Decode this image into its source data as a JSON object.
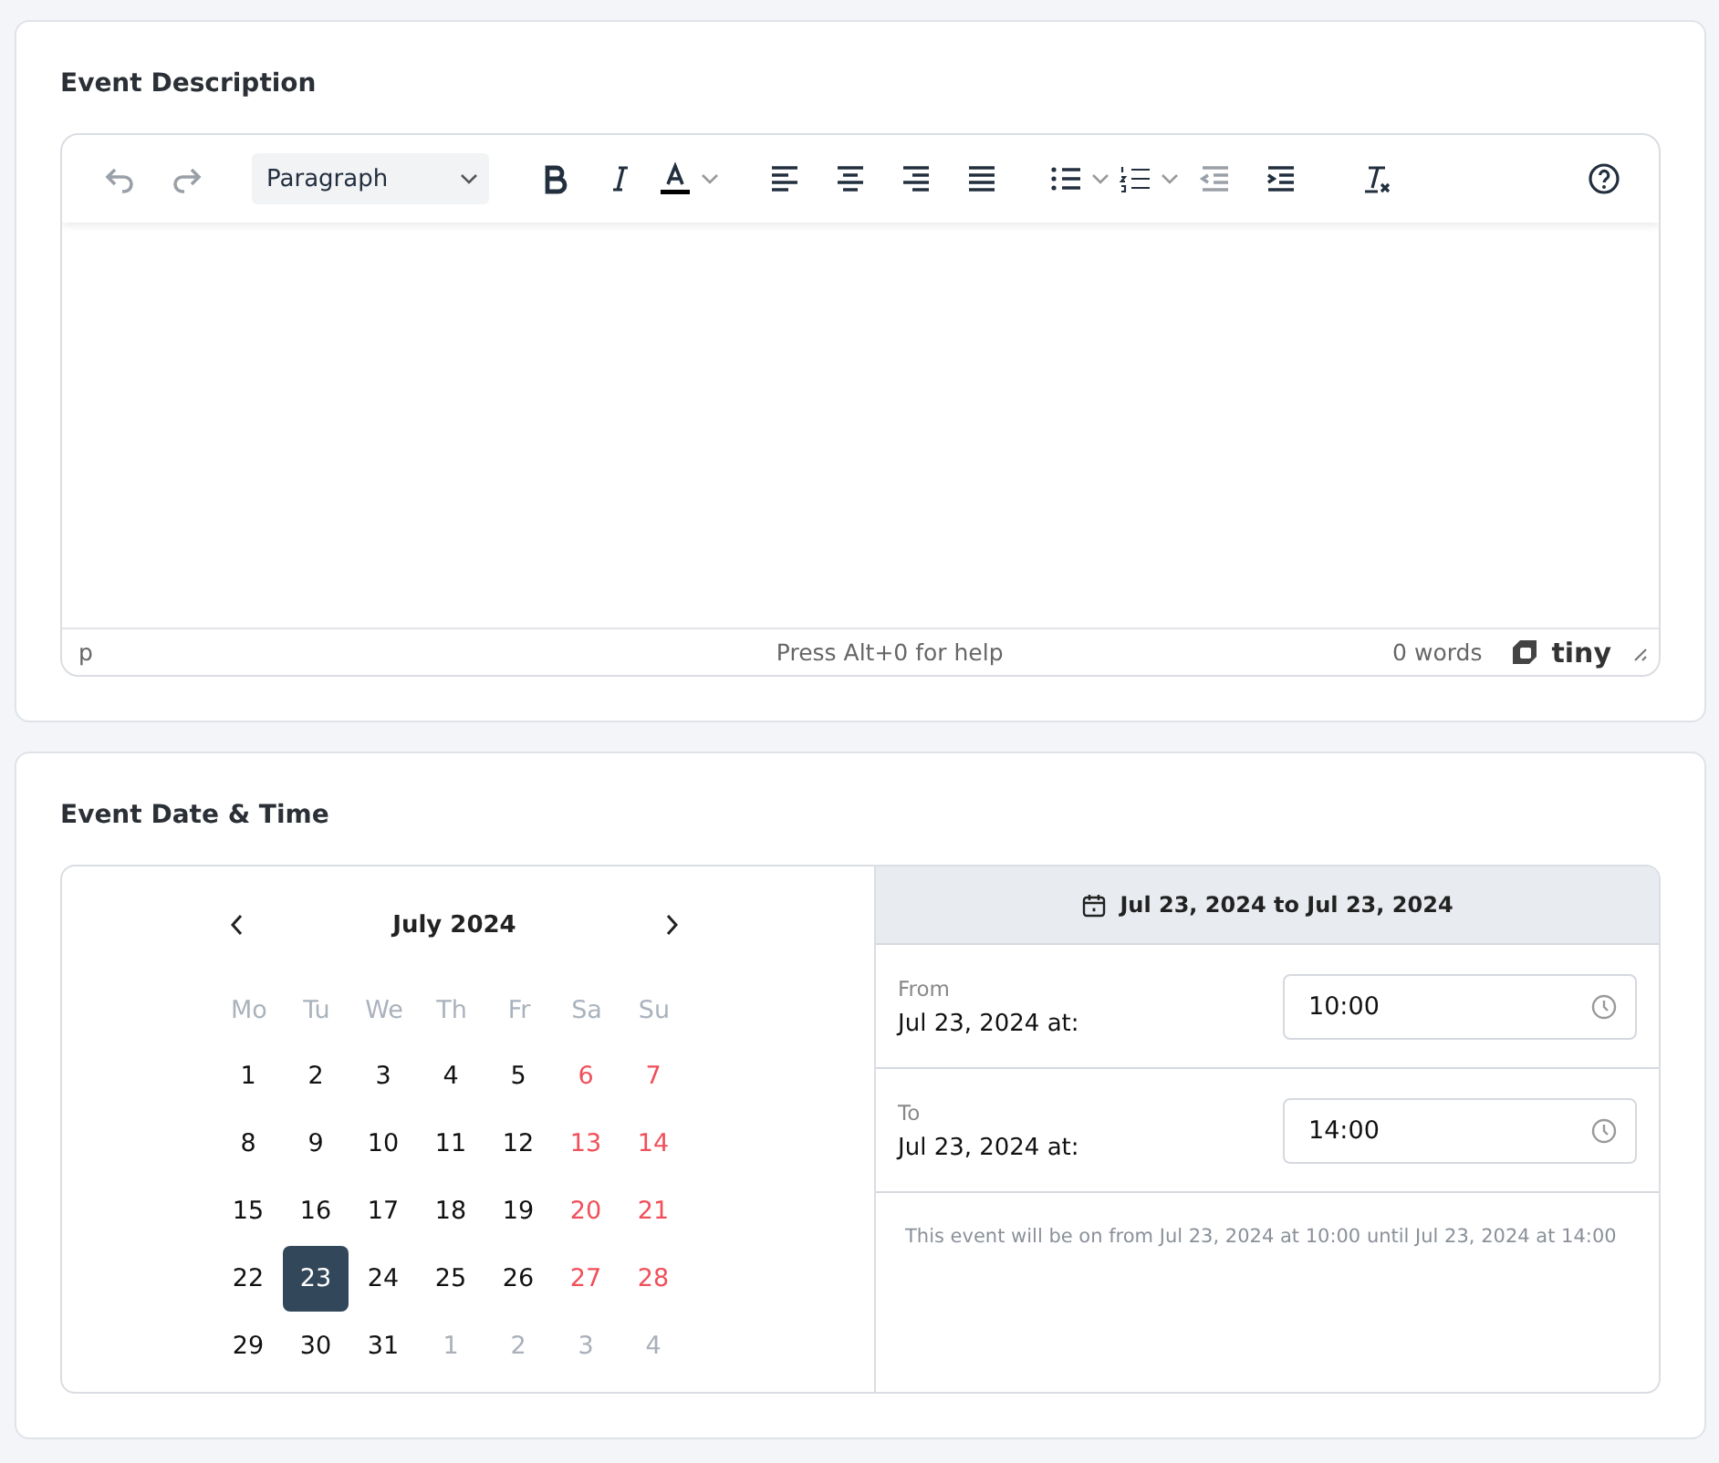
{
  "description_card": {
    "title": "Event Description",
    "toolbar": [
      [
        {
          "kind": "undo",
          "disabled": true
        },
        {
          "kind": "redo",
          "disabled": true
        }
      ],
      [
        {
          "kind": "blocks",
          "label": "Paragraph",
          "disabled": false
        }
      ],
      [
        {
          "kind": "bold",
          "disabled": false
        },
        {
          "kind": "italic",
          "disabled": false
        },
        {
          "kind": "forecolor",
          "disabled": false
        }
      ],
      [
        {
          "kind": "align-left",
          "disabled": false
        },
        {
          "kind": "align-center",
          "disabled": false
        },
        {
          "kind": "align-right",
          "disabled": false
        },
        {
          "kind": "justify",
          "disabled": false
        }
      ],
      [
        {
          "kind": "bullist",
          "disabled": false
        },
        {
          "kind": "numlist",
          "disabled": false
        },
        {
          "kind": "outdent",
          "disabled": true
        },
        {
          "kind": "indent",
          "disabled": false
        }
      ],
      [
        {
          "kind": "removeformat",
          "disabled": false
        }
      ],
      [
        {
          "kind": "help",
          "disabled": false
        }
      ]
    ],
    "status_bar": {
      "path": "p",
      "help": "Press Alt+0 for help",
      "word_count": "0 words",
      "brand": "tiny"
    }
  },
  "date_card": {
    "title": "Event Date & Time",
    "calendar": {
      "month": "July 2024",
      "weekdays": [
        "Mo",
        "Tu",
        "We",
        "Th",
        "Fr",
        "Sa",
        "Su"
      ],
      "days": [
        {
          "text": "1",
          "kind": "weekday",
          "selected": false
        },
        {
          "text": "2",
          "kind": "weekday",
          "selected": false
        },
        {
          "text": "3",
          "kind": "weekday",
          "selected": false
        },
        {
          "text": "4",
          "kind": "weekday",
          "selected": false
        },
        {
          "text": "5",
          "kind": "weekday",
          "selected": false
        },
        {
          "text": "6",
          "kind": "weekend",
          "selected": false
        },
        {
          "text": "7",
          "kind": "weekend",
          "selected": false
        },
        {
          "text": "8",
          "kind": "weekday",
          "selected": false
        },
        {
          "text": "9",
          "kind": "weekday",
          "selected": false
        },
        {
          "text": "10",
          "kind": "weekday",
          "selected": false
        },
        {
          "text": "11",
          "kind": "weekday",
          "selected": false
        },
        {
          "text": "12",
          "kind": "weekday",
          "selected": false
        },
        {
          "text": "13",
          "kind": "weekend",
          "selected": false
        },
        {
          "text": "14",
          "kind": "weekend",
          "selected": false
        },
        {
          "text": "15",
          "kind": "weekday",
          "selected": false
        },
        {
          "text": "16",
          "kind": "weekday",
          "selected": false
        },
        {
          "text": "17",
          "kind": "weekday",
          "selected": false
        },
        {
          "text": "18",
          "kind": "weekday",
          "selected": false
        },
        {
          "text": "19",
          "kind": "weekday",
          "selected": false
        },
        {
          "text": "20",
          "kind": "weekend",
          "selected": false
        },
        {
          "text": "21",
          "kind": "weekend",
          "selected": false
        },
        {
          "text": "22",
          "kind": "weekday",
          "selected": false
        },
        {
          "text": "23",
          "kind": "weekday",
          "selected": true
        },
        {
          "text": "24",
          "kind": "weekday",
          "selected": false
        },
        {
          "text": "25",
          "kind": "weekday",
          "selected": false
        },
        {
          "text": "26",
          "kind": "weekday",
          "selected": false
        },
        {
          "text": "27",
          "kind": "weekend",
          "selected": false
        },
        {
          "text": "28",
          "kind": "weekend",
          "selected": false
        },
        {
          "text": "29",
          "kind": "weekday",
          "selected": false
        },
        {
          "text": "30",
          "kind": "weekday",
          "selected": false
        },
        {
          "text": "31",
          "kind": "weekday",
          "selected": false
        },
        {
          "text": "1",
          "kind": "outside",
          "selected": false
        },
        {
          "text": "2",
          "kind": "outside",
          "selected": false
        },
        {
          "text": "3",
          "kind": "outside",
          "selected": false
        },
        {
          "text": "4",
          "kind": "outside",
          "selected": false
        }
      ]
    },
    "range": {
      "header": "Jul 23, 2024 to Jul 23, 2024",
      "rows": [
        {
          "label": "From",
          "date": "Jul 23, 2024 at:",
          "time": "10:00"
        },
        {
          "label": "To",
          "date": "Jul 23, 2024 at:",
          "time": "14:00"
        }
      ],
      "summary": "This event will be on from Jul 23, 2024 at 10:00 until Jul 23, 2024 at 14:00"
    }
  }
}
